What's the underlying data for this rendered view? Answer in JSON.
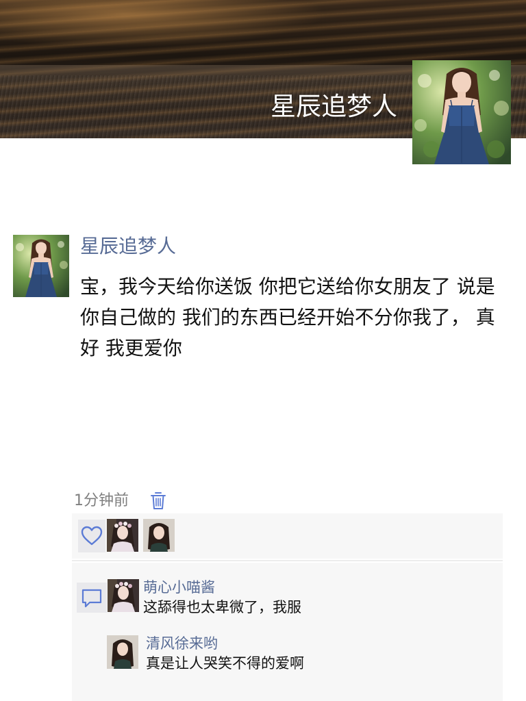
{
  "profile": {
    "cover_name": "星辰追梦人"
  },
  "post": {
    "author": "星辰追梦人",
    "text": "宝，我今天给你送饭 你把它送给你女朋友了 说是你自己做的 我们的东西已经开始不分你我了， 真好 我更爱你",
    "time": "1分钟前"
  },
  "likes": {
    "icon": "heart-outline-icon",
    "avatars": [
      "liker-avatar-flower-crown",
      "liker-avatar-long-hair"
    ]
  },
  "comments": [
    {
      "author": "萌心小喵酱",
      "text": "这舔得也太卑微了，我服"
    },
    {
      "author": "清风徐来哟",
      "text": "真是让人哭笑不得的爱啊"
    }
  ],
  "colors": {
    "link": "#576b95",
    "text": "#111111",
    "meta": "#7f7f7f",
    "panel": "#f7f7f7",
    "icon_blue": "#5b7bd5"
  }
}
